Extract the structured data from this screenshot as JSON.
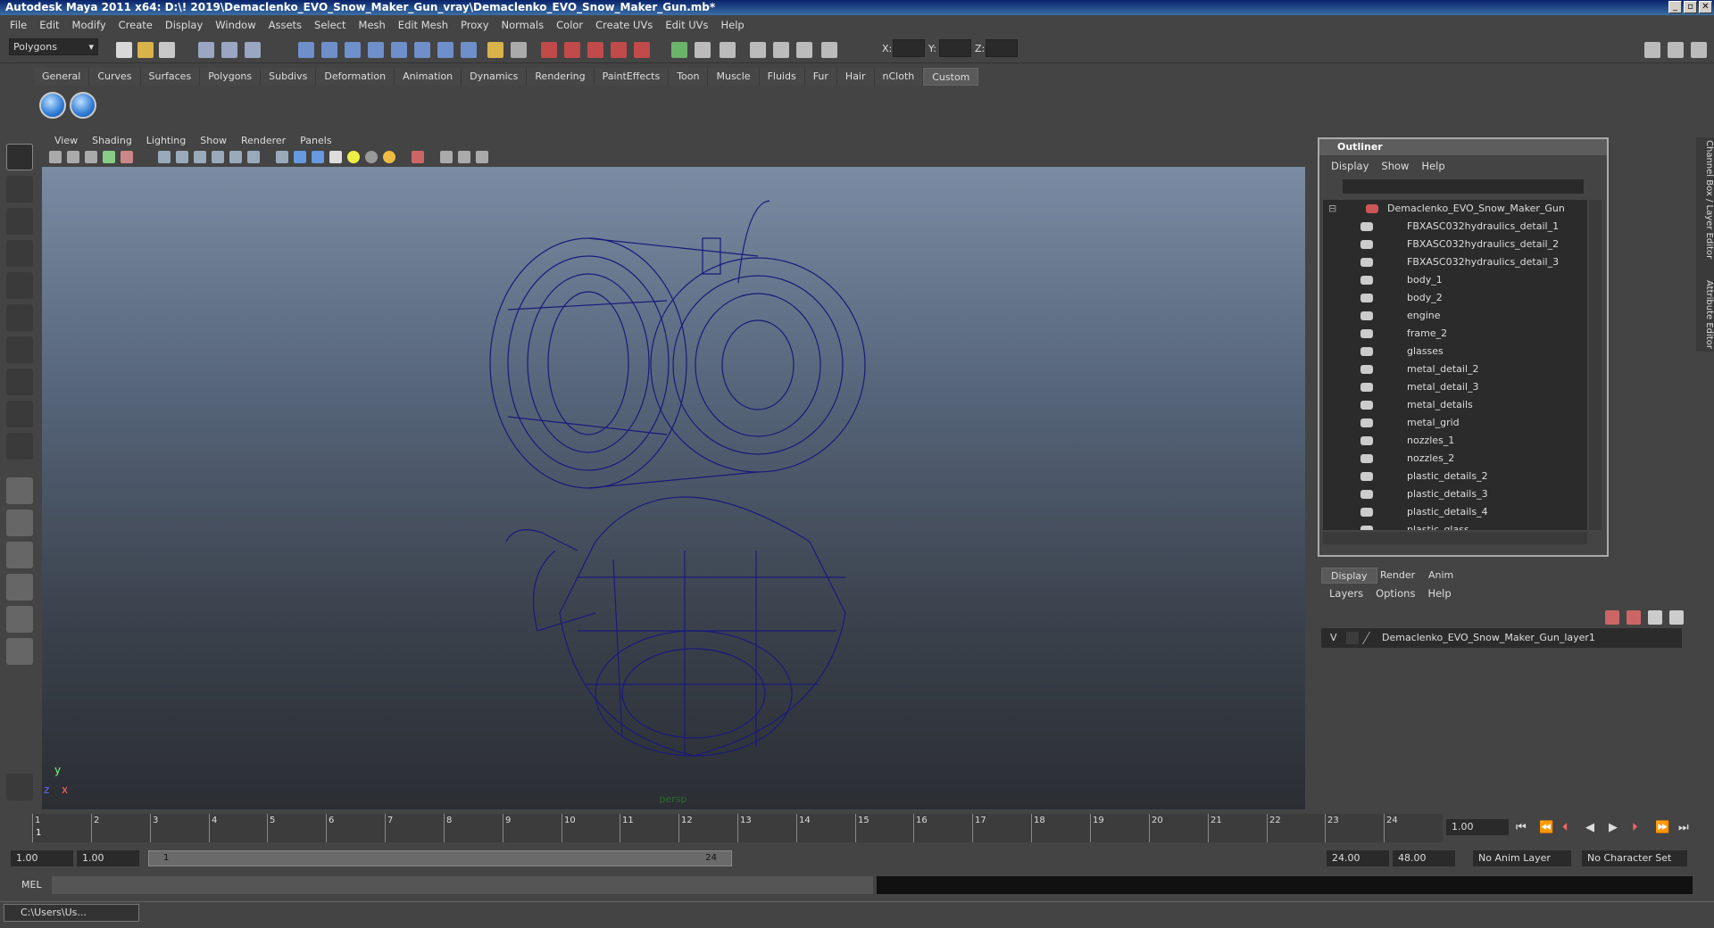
{
  "titlebar": {
    "title": "Autodesk Maya 2011 x64: D:\\! 2019\\Demaclenko_EVO_Snow_Maker_Gun_vray\\Demaclenko_EVO_Snow_Maker_Gun.mb*",
    "min": "_",
    "max": "▫",
    "close": "✕"
  },
  "menubar": [
    "File",
    "Edit",
    "Modify",
    "Create",
    "Display",
    "Window",
    "Assets",
    "Select",
    "Mesh",
    "Edit Mesh",
    "Proxy",
    "Normals",
    "Color",
    "Create UVs",
    "Edit UVs",
    "Help"
  ],
  "statusline": {
    "mode": "Polygons",
    "x_label": "X:",
    "y_label": "Y:",
    "z_label": "Z:"
  },
  "shelf": {
    "tabs": [
      "General",
      "Curves",
      "Surfaces",
      "Polygons",
      "Subdivs",
      "Deformation",
      "Animation",
      "Dynamics",
      "Rendering",
      "PaintEffects",
      "Toon",
      "Muscle",
      "Fluids",
      "Fur",
      "Hair",
      "nCloth",
      "Custom"
    ],
    "active": "Custom"
  },
  "viewport": {
    "menus": [
      "View",
      "Shading",
      "Lighting",
      "Show",
      "Renderer",
      "Panels"
    ],
    "camera": "persp",
    "axis_y": "y",
    "axis_x": "x",
    "axis_z": "z",
    "wire_color": "#1a1a7a"
  },
  "outliner": {
    "title": "Outliner",
    "menus": [
      "Display",
      "Show",
      "Help"
    ],
    "root": "Demaclenko_EVO_Snow_Maker_Gun",
    "items": [
      "FBXASC032hydraulics_detail_1",
      "FBXASC032hydraulics_detail_2",
      "FBXASC032hydraulics_detail_3",
      "body_1",
      "body_2",
      "engine",
      "frame_2",
      "glasses",
      "metal_detail_2",
      "metal_detail_3",
      "metal_details",
      "metal_grid",
      "nozzles_1",
      "nozzles_2",
      "plastic_details_2",
      "plastic_details_3",
      "plastic_details_4",
      "plastic_glass"
    ]
  },
  "channelbox": {
    "tab1": "Channel Box / Layer Editor",
    "tab2": "Attribute Editor"
  },
  "layers": {
    "tabs": [
      "Display",
      "Render",
      "Anim"
    ],
    "menus": [
      "Layers",
      "Options",
      "Help"
    ],
    "row": {
      "vis": "V",
      "name": "Demaclenko_EVO_Snow_Maker_Gun_layer1"
    }
  },
  "timeline": {
    "ticks": [
      "1",
      "2",
      "3",
      "4",
      "5",
      "6",
      "7",
      "8",
      "9",
      "10",
      "11",
      "12",
      "13",
      "14",
      "15",
      "16",
      "17",
      "18",
      "19",
      "20",
      "21",
      "22",
      "23",
      "24"
    ],
    "current_frame": "1.00",
    "playhead": "1"
  },
  "range": {
    "start": "1.00",
    "start2": "1.00",
    "slider_start": "1",
    "slider_end": "24",
    "end": "24.00",
    "end2": "48.00",
    "anim_layer": "No Anim Layer",
    "char_set": "No Character Set"
  },
  "cmdline": {
    "label": "MEL"
  },
  "taskbar": {
    "item": "C:\\Users\\Us..."
  }
}
